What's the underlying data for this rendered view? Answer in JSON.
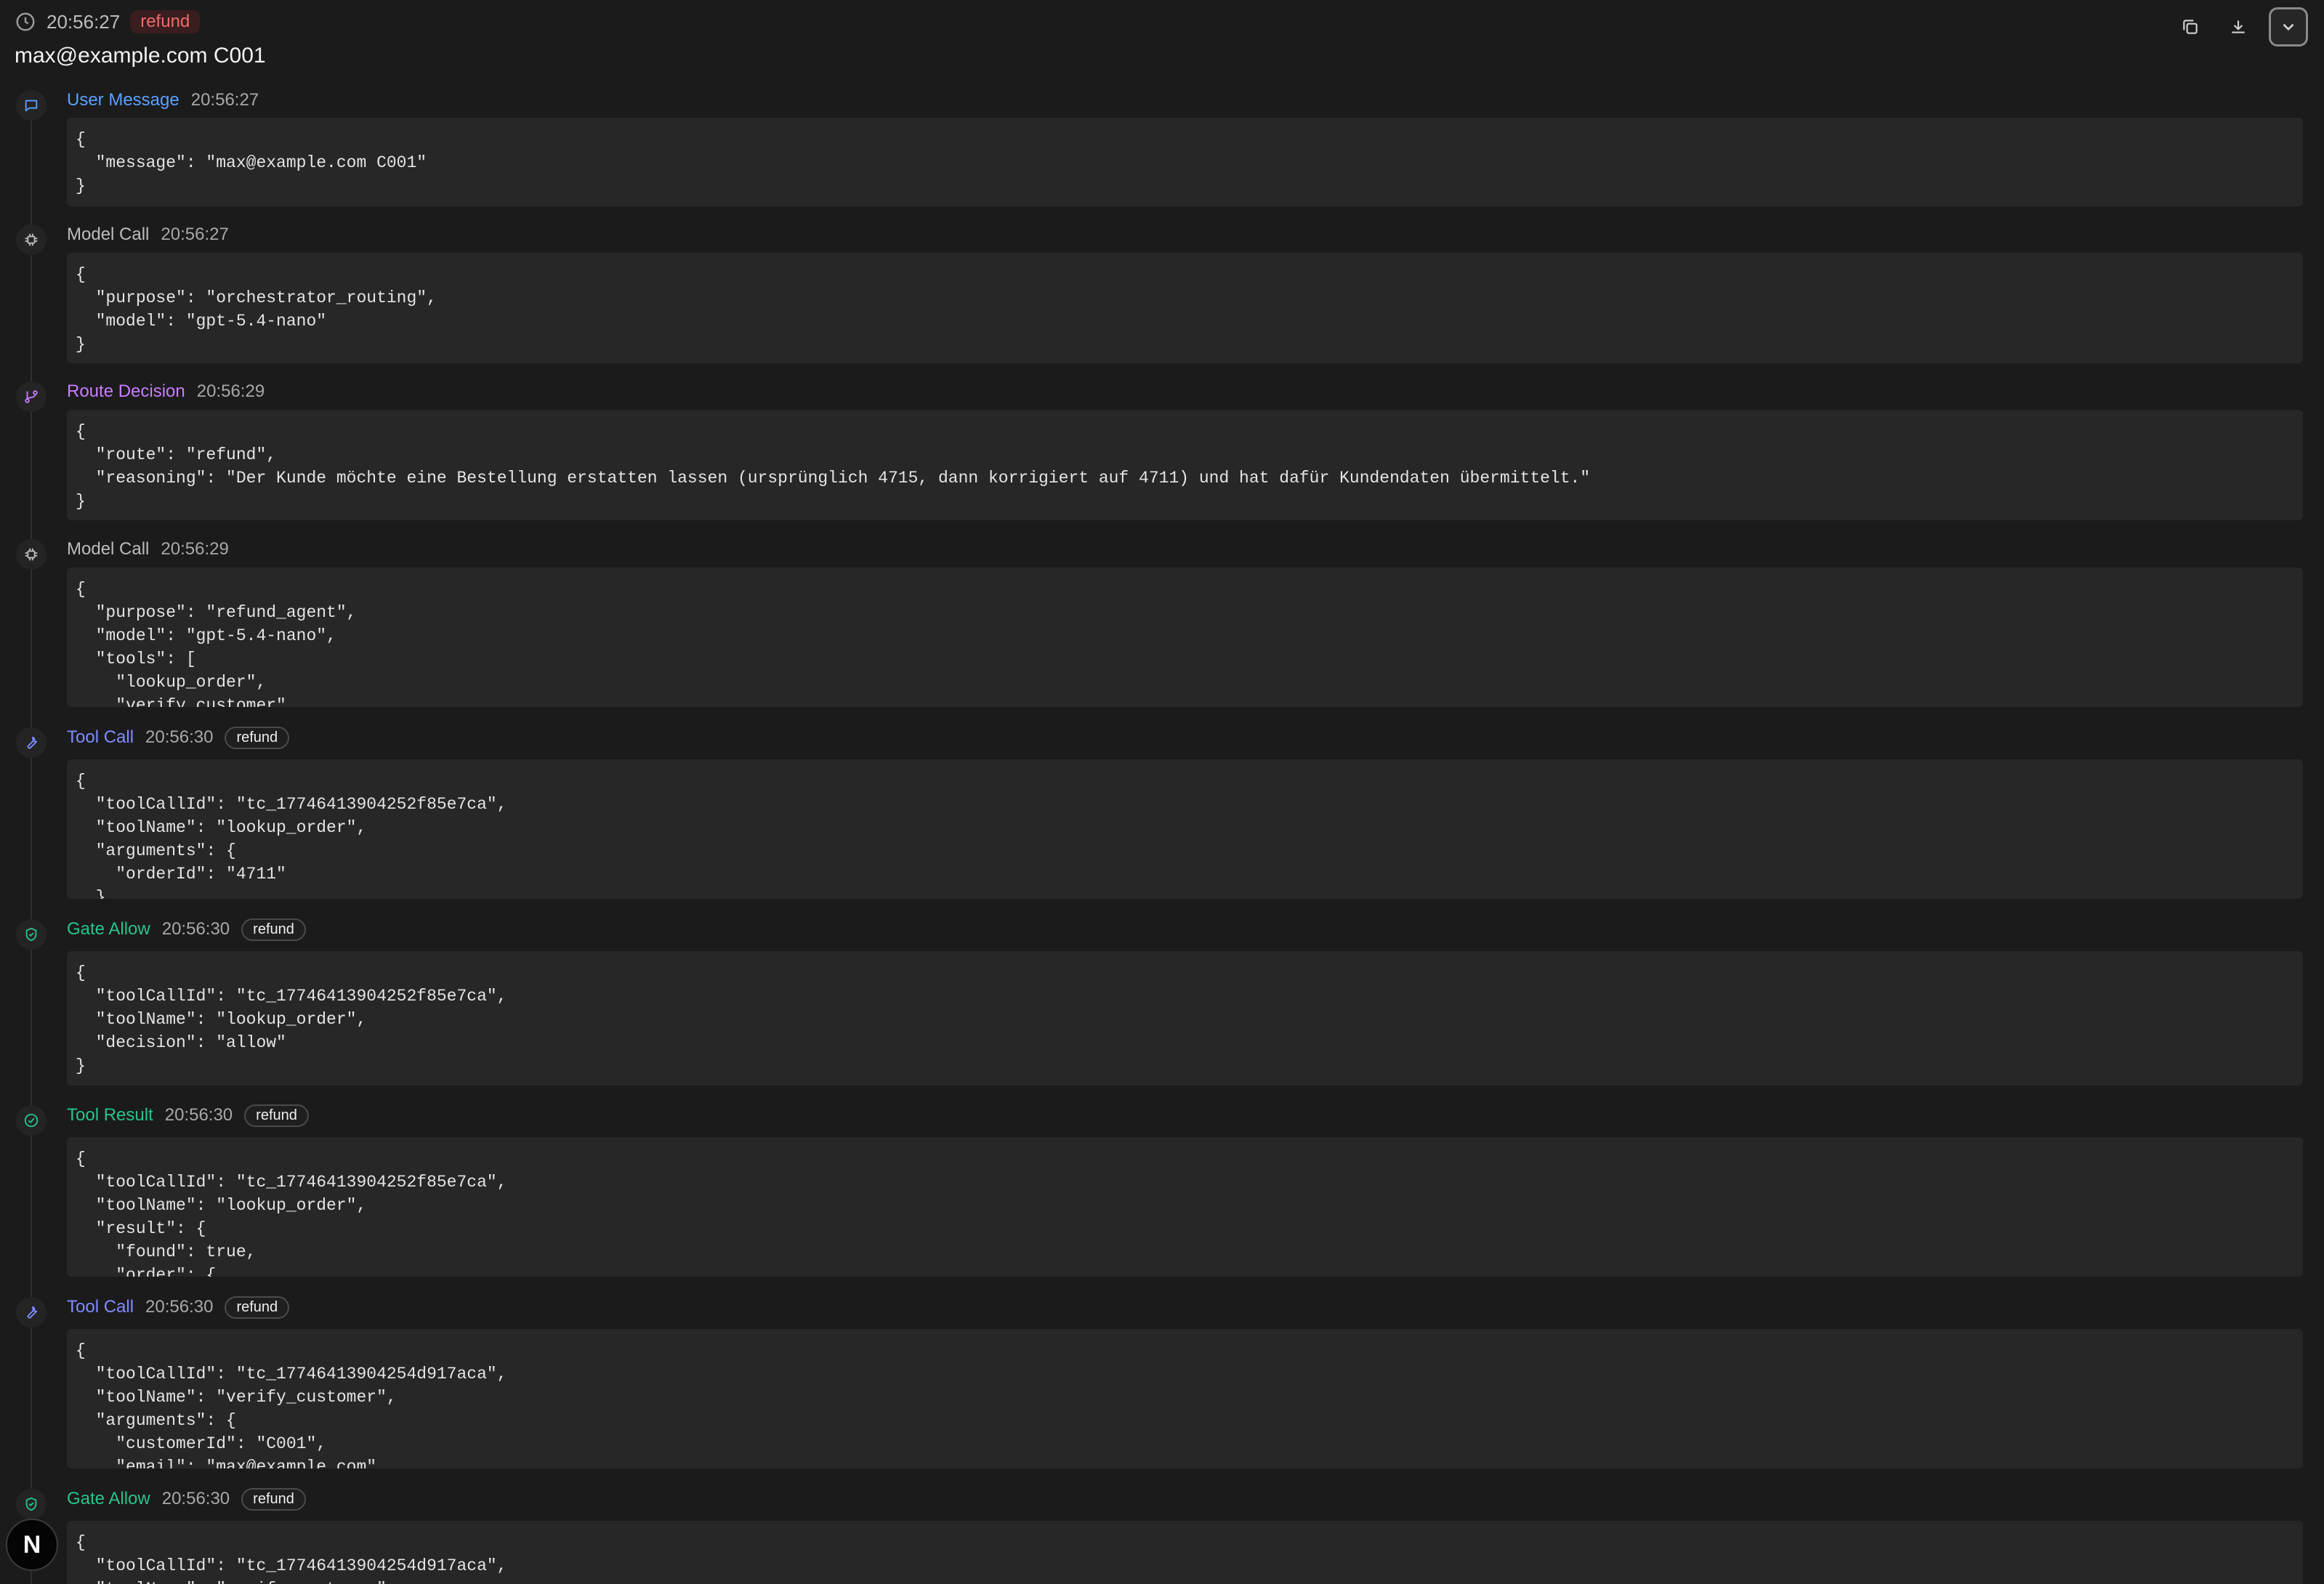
{
  "header": {
    "time": "20:56:27",
    "route_badge": "refund",
    "title": "max@example.com C001"
  },
  "logo_letter": "N",
  "events": [
    {
      "type": "User Message",
      "time": "20:56:27",
      "tag": "",
      "content": "{\n  \"message\": \"max@example.com C001\"\n}"
    },
    {
      "type": "Model Call",
      "time": "20:56:27",
      "tag": "",
      "content": "{\n  \"purpose\": \"orchestrator_routing\",\n  \"model\": \"gpt-5.4-nano\"\n}"
    },
    {
      "type": "Route Decision",
      "time": "20:56:29",
      "tag": "",
      "content": "{\n  \"route\": \"refund\",\n  \"reasoning\": \"Der Kunde möchte eine Bestellung erstatten lassen (ursprünglich 4715, dann korrigiert auf 4711) und hat dafür Kundendaten übermittelt.\"\n}"
    },
    {
      "type": "Model Call",
      "time": "20:56:29",
      "tag": "",
      "content": "{\n  \"purpose\": \"refund_agent\",\n  \"model\": \"gpt-5.4-nano\",\n  \"tools\": [\n    \"lookup_order\",\n    \"verify_customer\","
    },
    {
      "type": "Tool Call",
      "time": "20:56:30",
      "tag": "refund",
      "content": "{\n  \"toolCallId\": \"tc_17746413904252f85e7ca\",\n  \"toolName\": \"lookup_order\",\n  \"arguments\": {\n    \"orderId\": \"4711\"\n  }"
    },
    {
      "type": "Gate Allow",
      "time": "20:56:30",
      "tag": "refund",
      "content": "{\n  \"toolCallId\": \"tc_17746413904252f85e7ca\",\n  \"toolName\": \"lookup_order\",\n  \"decision\": \"allow\"\n}"
    },
    {
      "type": "Tool Result",
      "time": "20:56:30",
      "tag": "refund",
      "content": "{\n  \"toolCallId\": \"tc_17746413904252f85e7ca\",\n  \"toolName\": \"lookup_order\",\n  \"result\": {\n    \"found\": true,\n    \"order\": {"
    },
    {
      "type": "Tool Call",
      "time": "20:56:30",
      "tag": "refund",
      "content": "{\n  \"toolCallId\": \"tc_17746413904254d917aca\",\n  \"toolName\": \"verify_customer\",\n  \"arguments\": {\n    \"customerId\": \"C001\",\n    \"email\": \"max@example.com\""
    },
    {
      "type": "Gate Allow",
      "time": "20:56:30",
      "tag": "refund",
      "content": "{\n  \"toolCallId\": \"tc_17746413904254d917aca\",\n  \"toolName\": \"verify_customer\","
    }
  ]
}
